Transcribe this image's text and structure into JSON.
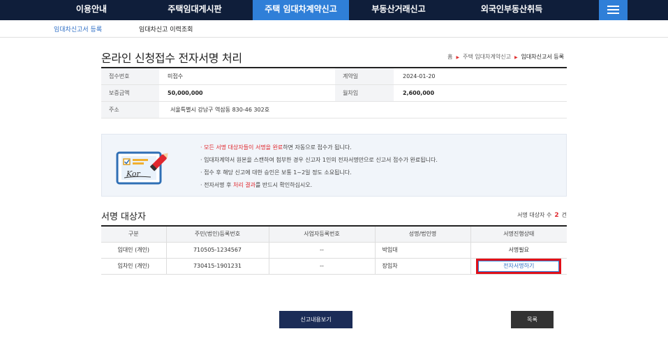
{
  "topnav": {
    "items": [
      {
        "label": "이용안내"
      },
      {
        "label": "주택임대게시판"
      },
      {
        "label": "주택 임대차계약신고"
      },
      {
        "label": "부동산거래신고"
      },
      {
        "label": "외국인부동산취득"
      }
    ],
    "active_index": 2
  },
  "subnav": {
    "items": [
      {
        "label": "임대차신고서 등록"
      },
      {
        "label": "임대차신고 이력조회"
      }
    ]
  },
  "page": {
    "title": "온라인 신청접수 전자서명 처리",
    "breadcrumb": [
      "홈",
      "주택 임대차계약신고",
      "임대차신고서 등록"
    ]
  },
  "info": {
    "receipt_no_label": "접수번호",
    "receipt_no_value": "미접수",
    "contract_date_label": "계약일",
    "contract_date_value": "2024-01-20",
    "deposit_label": "보증금액",
    "deposit_value": "50,000,000",
    "monthly_rent_label": "월차임",
    "monthly_rent_value": "2,600,000",
    "address_label": "주소",
    "address_value": "서울특별시 강남구 역삼동 830-46 302호"
  },
  "notice": {
    "line1_red": "· 모든 서명 대상자들이 서명을 완료",
    "line1_rest": "하면 자동으로 접수가 됩니다.",
    "line2": "· 임대차계약서 원본을 스캔하여 첨부한 경우 신고자 1인의 전자서명만으로 신고서 접수가 완료됩니다.",
    "line3": "· 접수 후 해당 신고에 대한 승인은 보통 1~2일 정도 소요됩니다.",
    "line4_pre": "· 전자서명 후 ",
    "line4_red": "처리 결과",
    "line4_post": "를 반드시 확인하십시오.",
    "icon_text": "Kor"
  },
  "signers": {
    "title": "서명 대상자",
    "count_label": "서명 대상자 수",
    "count": "2",
    "count_unit": "건",
    "headers": [
      "구분",
      "주민(법인)등록번호",
      "사업자등록번호",
      "성명/법인명",
      "서명진행상태"
    ],
    "rows": [
      {
        "type": "임대인 (개인)",
        "id": "710505-1234567",
        "biz": "--",
        "name": "박임대",
        "status": "서명필요"
      },
      {
        "type": "임차인 (개인)",
        "id": "730415-1901231",
        "biz": "--",
        "name": "장임차",
        "status_button": "전자서명하기"
      }
    ]
  },
  "buttons": {
    "view": "신고내용보기",
    "list": "목록"
  },
  "colors": {
    "nav_bg": "#0f1e3a",
    "accent": "#2f7fd8",
    "highlight": "#e0101a"
  }
}
